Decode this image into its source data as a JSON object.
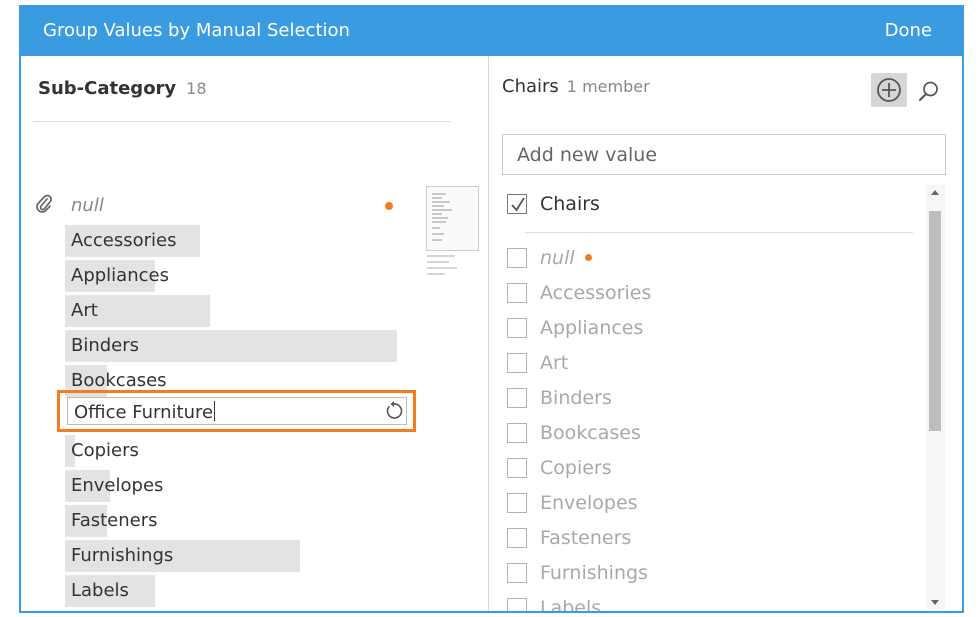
{
  "dialog": {
    "title": "Group Values by Manual Selection",
    "done_label": "Done"
  },
  "left": {
    "field_name": "Sub-Category",
    "field_count": "18",
    "null_label": "null",
    "values": [
      {
        "label": "Accessories",
        "fill": 0.39
      },
      {
        "label": "Appliances",
        "fill": 0.26
      },
      {
        "label": "Art",
        "fill": 0.42
      },
      {
        "label": "Binders",
        "fill": 0.96
      },
      {
        "label": "Bookcases",
        "fill": 0.12
      }
    ],
    "editing_value": "Office Furniture",
    "values_after": [
      {
        "label": "Copiers",
        "fill": 0.03
      },
      {
        "label": "Envelopes",
        "fill": 0.13
      },
      {
        "label": "Fasteners",
        "fill": 0.12
      },
      {
        "label": "Furnishings",
        "fill": 0.68
      },
      {
        "label": "Labels",
        "fill": 0.26
      }
    ]
  },
  "right": {
    "group_name": "Chairs",
    "group_members": "1 member",
    "add_placeholder": "Add new value",
    "checked_item": "Chairs",
    "null_label": "null",
    "items": [
      "Accessories",
      "Appliances",
      "Art",
      "Binders",
      "Bookcases",
      "Copiers",
      "Envelopes",
      "Fasteners",
      "Furnishings",
      "Labels"
    ]
  },
  "icons": {
    "clip": "paperclip-icon",
    "reset": "reset-icon",
    "add": "plus-circle-icon",
    "search": "search-icon"
  },
  "colors": {
    "title_bar": "#3b9be0",
    "accent_orange": "#f47c1f",
    "value_bar": "#e2e3e2"
  }
}
